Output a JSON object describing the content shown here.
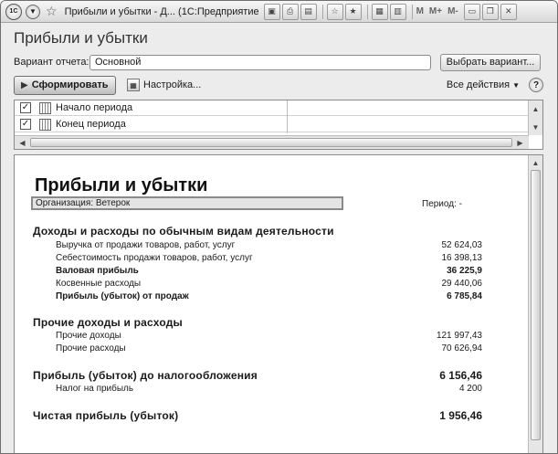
{
  "window": {
    "title": "Прибыли и убытки - Д... (1С:Предприятие)",
    "logo": "1С",
    "toolbar_m": [
      "M",
      "M+",
      "M-"
    ]
  },
  "form": {
    "title": "Прибыли и убытки",
    "variant_label": "Вариант отчета:",
    "variant_value": "Основной",
    "choose_variant": "Выбрать вариант...",
    "generate": "Сформировать",
    "settings": "Настройка...",
    "all_actions": "Все действия",
    "help": "?"
  },
  "params": [
    {
      "checked": true,
      "label": "Начало периода"
    },
    {
      "checked": true,
      "label": "Конец периода"
    }
  ],
  "report": {
    "title": "Прибыли и убытки",
    "organization": "Организация: Ветерок",
    "period": "Период:  -",
    "sections": {
      "s1": "Доходы и расходы по обычным видам деятельности",
      "s2": "Прочие доходы и расходы",
      "s3": "Прибыль (убыток) до налогообложения",
      "s4": "Чистая прибыль (убыток)"
    },
    "rows": {
      "revenue": {
        "label": "Выручка от продажи товаров, работ, услуг",
        "value": "52 624,03"
      },
      "cost": {
        "label": "Себестоимость продажи товаров, работ, услуг",
        "value": "16 398,13"
      },
      "gross": {
        "label": "Валовая прибыль",
        "value": "36 225,9"
      },
      "indirect": {
        "label": "Косвенные расходы",
        "value": "29 440,06"
      },
      "sales_profit": {
        "label": "Прибыль (убыток) от продаж",
        "value": "6 785,84"
      },
      "other_income": {
        "label": "Прочие доходы",
        "value": "121 997,43"
      },
      "other_exp": {
        "label": "Прочие расходы",
        "value": "70 626,94"
      },
      "pretax": {
        "value": "6 156,46"
      },
      "tax": {
        "label": "Налог на прибыль",
        "value": "4 200"
      },
      "net": {
        "value": "1 956,46"
      }
    }
  }
}
